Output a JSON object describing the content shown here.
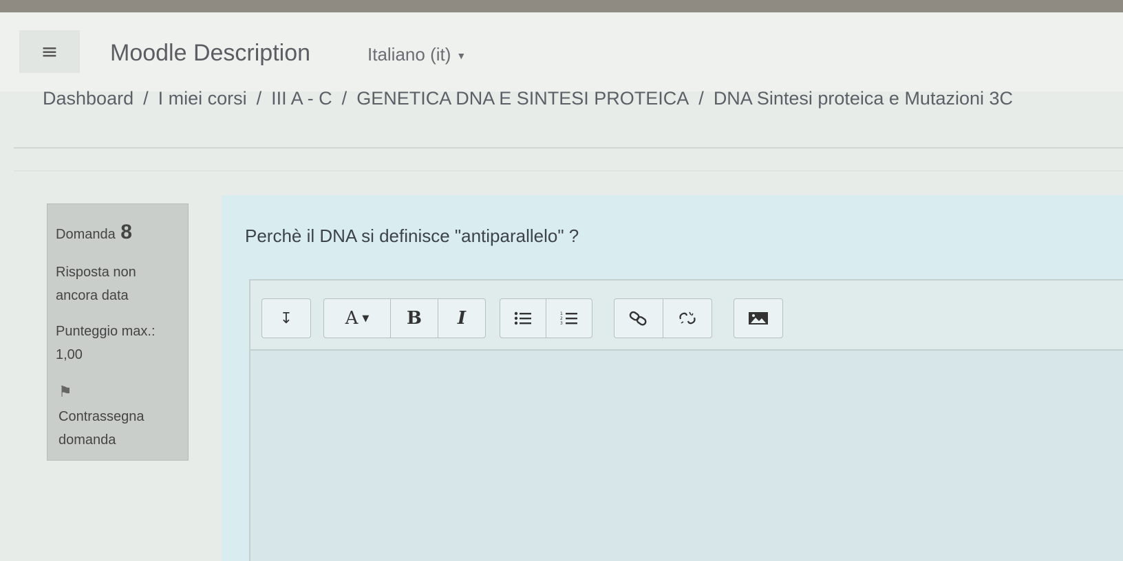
{
  "navbar": {
    "menu_icon": "hamburger-icon",
    "site_name": "Moodle Description",
    "language": "Italiano (it)"
  },
  "breadcrumb": {
    "items": [
      "Dashboard",
      "I miei corsi",
      "III A - C",
      "GENETICA DNA E SINTESI PROTEICA",
      "DNA Sintesi proteica e Mutazioni 3C"
    ],
    "separator": "/"
  },
  "question": {
    "label": "Domanda",
    "number": "8",
    "state": "Risposta non ancora data",
    "grade_label": "Punteggio max.:",
    "grade_value": "1,00",
    "flag_icon": "flag-icon",
    "flag_label": "Contrassegna domanda",
    "text": "Perchè il DNA si definisce \"antiparallelo\" ?"
  },
  "editor": {
    "toolbar": {
      "collapse": "↧",
      "style": "A",
      "bold": "B",
      "italic": "I",
      "unordered_list_icon": "unordered-list-icon",
      "ordered_list_icon": "ordered-list-icon",
      "link_icon": "link-icon",
      "unlink_icon": "unlink-icon",
      "image_icon": "image-icon"
    },
    "value": ""
  }
}
